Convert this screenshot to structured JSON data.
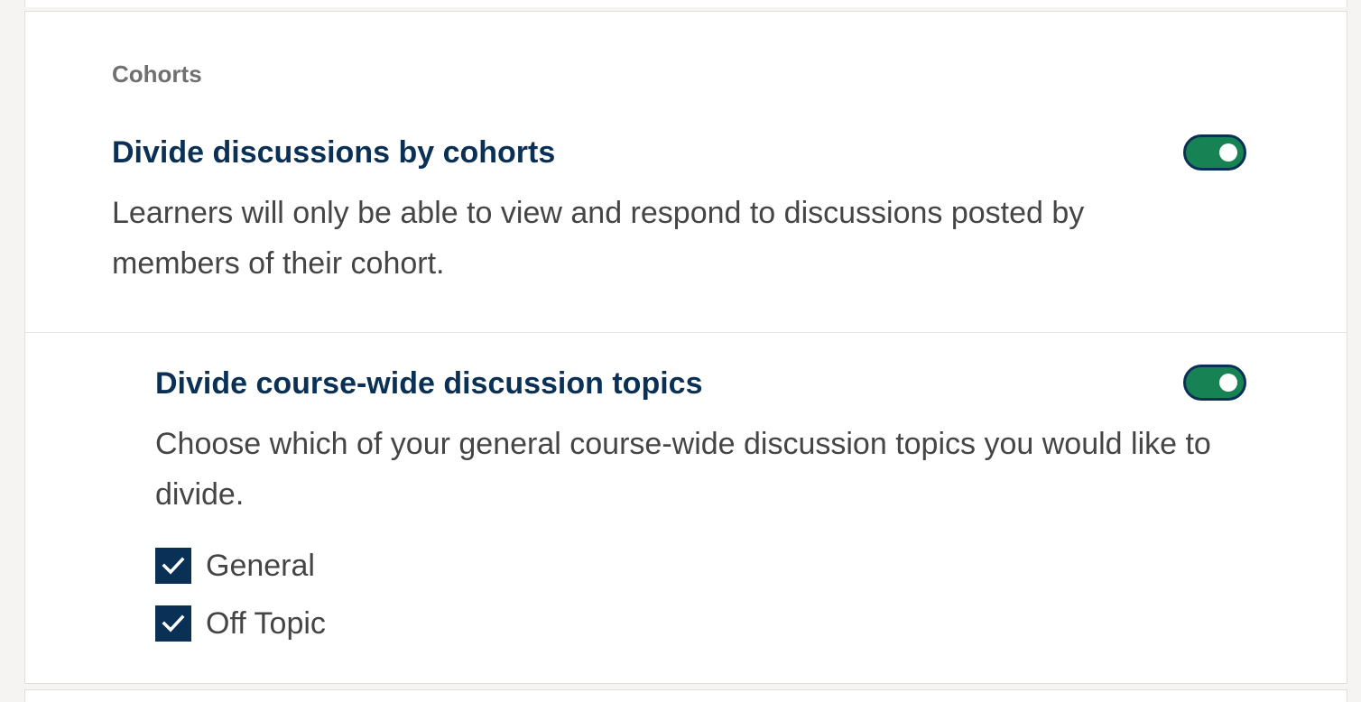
{
  "section": {
    "label": "Cohorts"
  },
  "settings": [
    {
      "title": "Divide discussions by cohorts",
      "description": "Learners will only be able to view and respond to discussions posted by members of their cohort.",
      "enabled": true
    },
    {
      "title": "Divide course-wide discussion topics",
      "description": "Choose which of your general course-wide discussion topics you would like to divide.",
      "enabled": true
    }
  ],
  "topics": [
    {
      "label": "General",
      "checked": true
    },
    {
      "label": "Off Topic",
      "checked": true
    }
  ],
  "colors": {
    "title": "#0a3055",
    "toggle_on": "#178253",
    "checkbox": "#0a3055",
    "label_gray": "#707070",
    "text": "#454545"
  },
  "icons": {
    "checkbox_mark": "check-icon"
  }
}
